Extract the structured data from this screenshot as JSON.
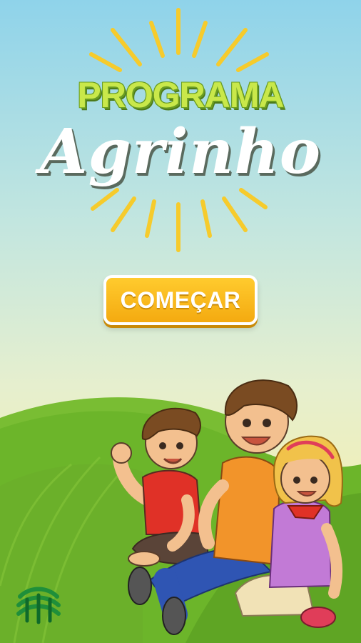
{
  "app": {
    "title_line1": "PROGRAMA",
    "title_line2": "Agrinho"
  },
  "actions": {
    "start_label": "COMEÇAR"
  },
  "colors": {
    "sky_top": "#8fd3ea",
    "sky_bottom": "#f2eeb0",
    "title_green": "#c9e84a",
    "button_yellow": "#ffcb2e",
    "grass_green": "#6cb52a",
    "ray_yellow": "#f6cb2c"
  },
  "icons": {
    "logo": "agrinho-logo-icon"
  }
}
